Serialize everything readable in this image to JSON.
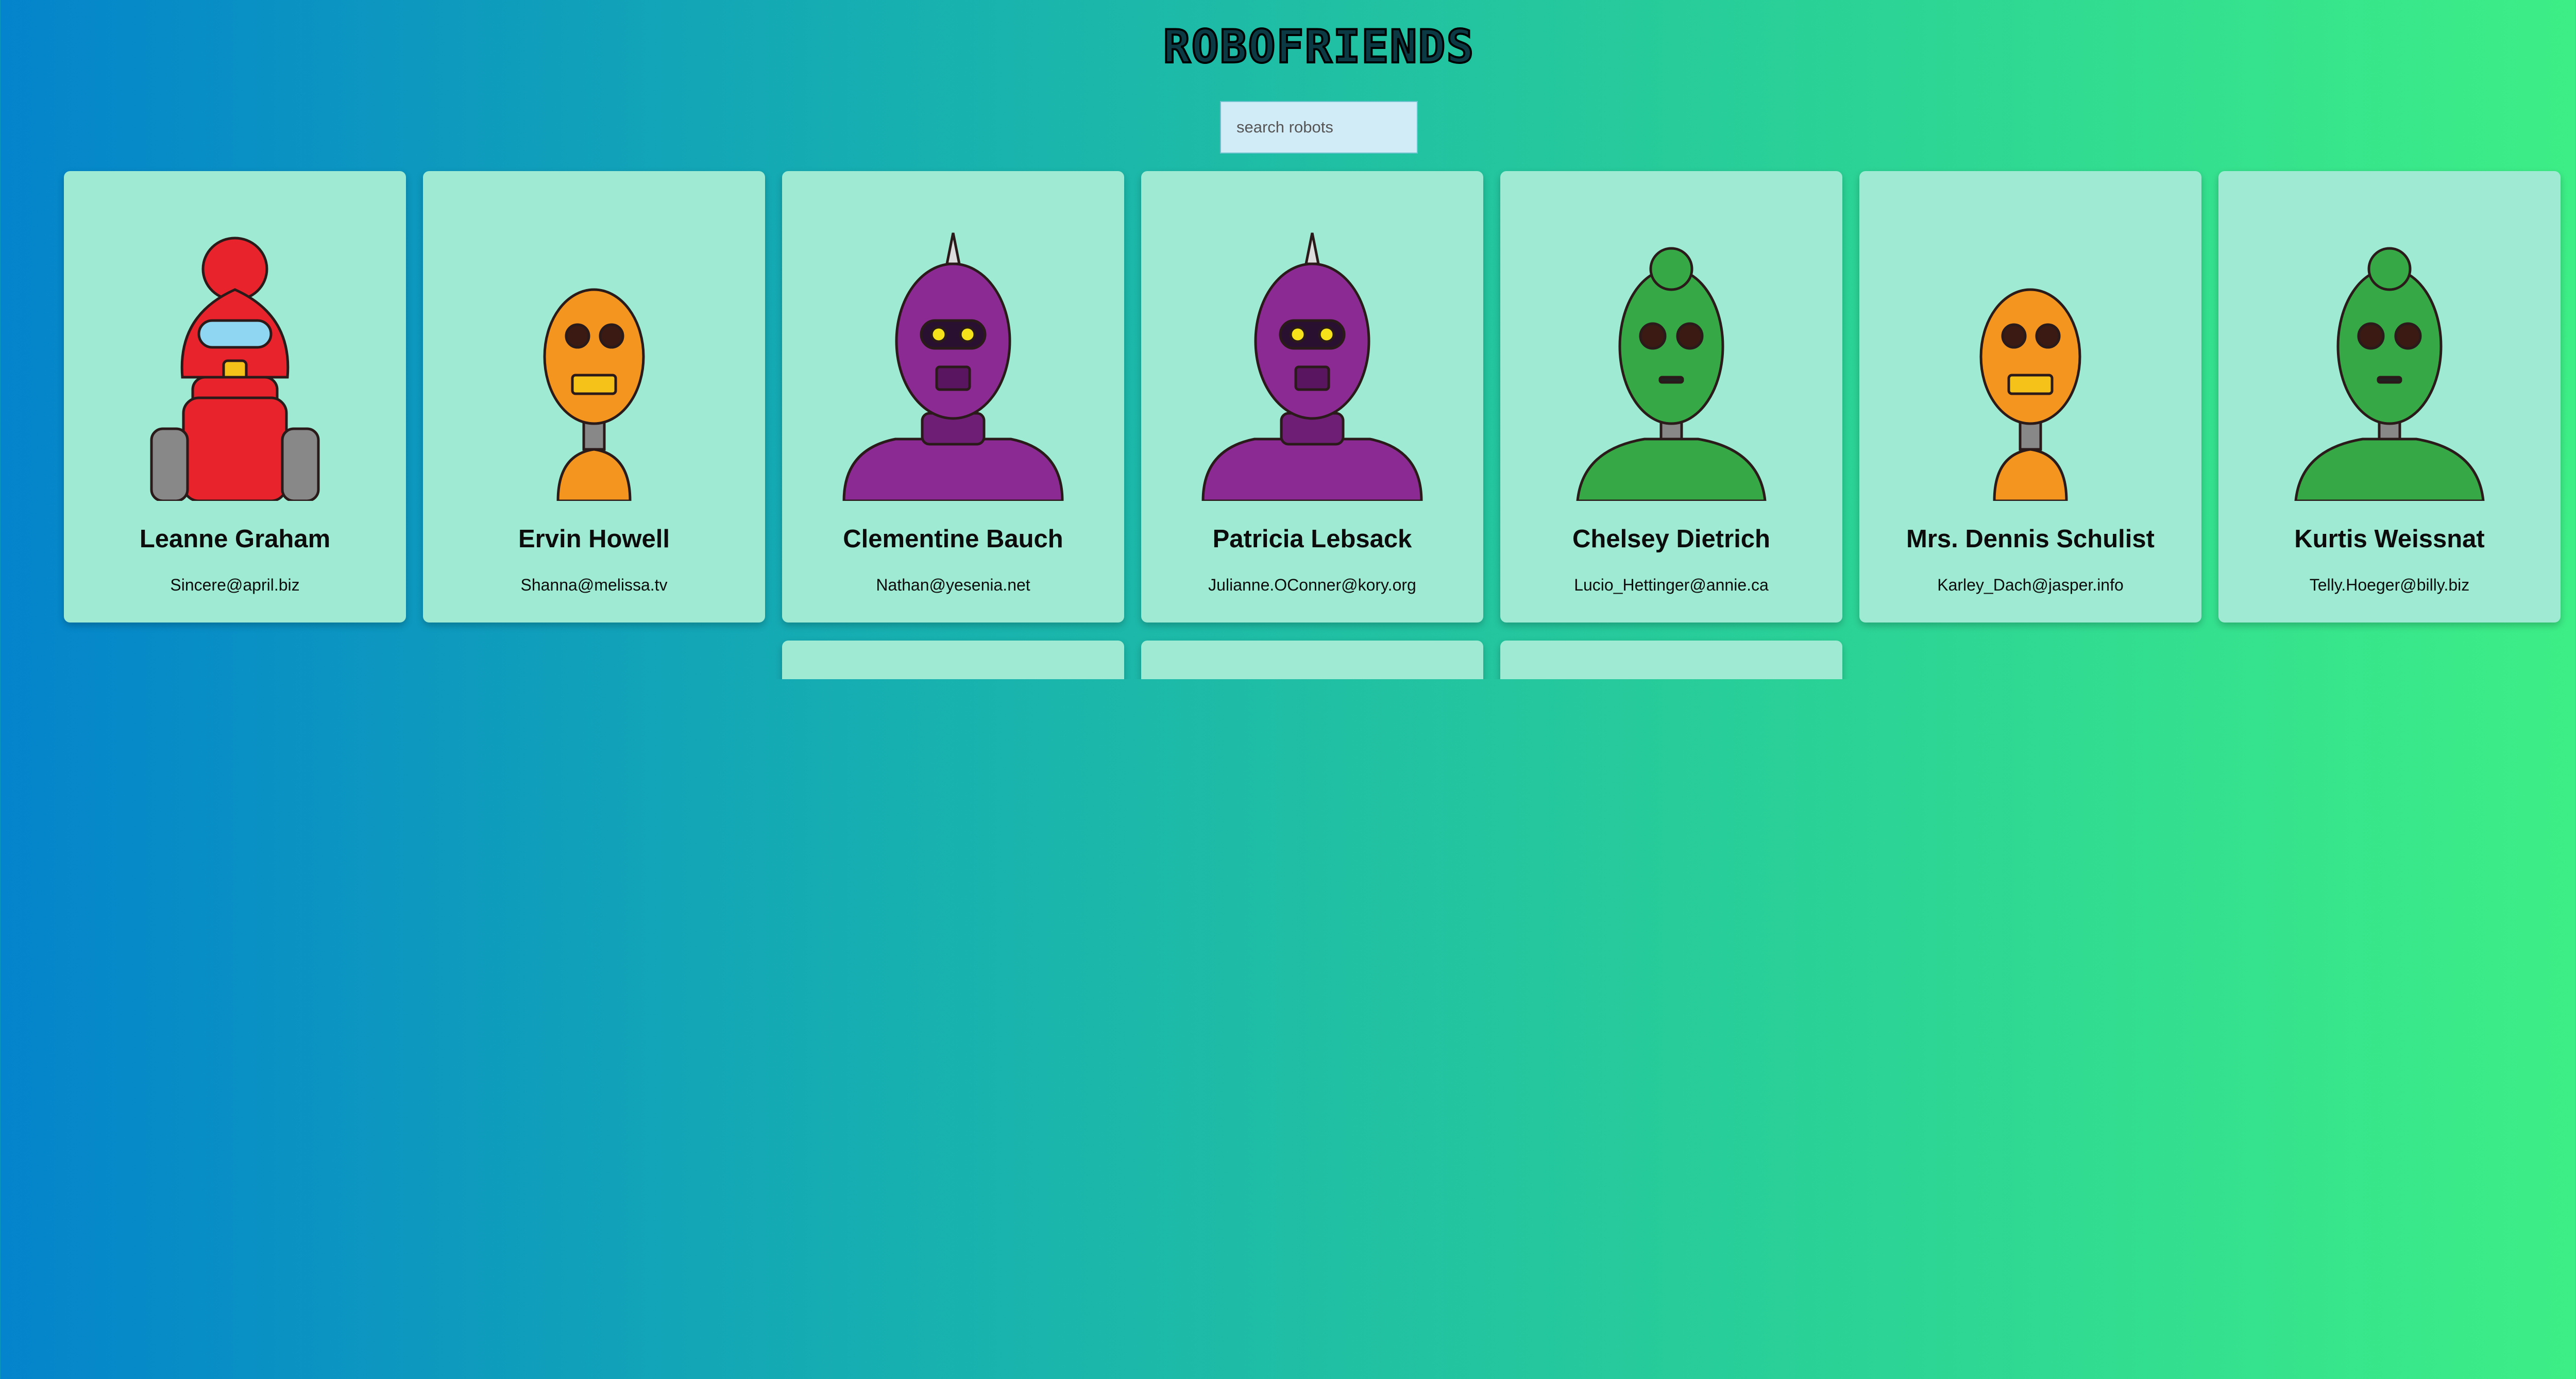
{
  "app": {
    "title": "ROBOFRIENDS"
  },
  "search": {
    "placeholder": "search robots",
    "value": ""
  },
  "cards": [
    {
      "name": "Leanne Graham",
      "email": "Sincere@april.biz",
      "robot": "red-robot-icon",
      "color": "#e8232b"
    },
    {
      "name": "Ervin Howell",
      "email": "Shanna@melissa.tv",
      "robot": "orange-robot-icon",
      "color": "#f4951f"
    },
    {
      "name": "Clementine Bauch",
      "email": "Nathan@yesenia.net",
      "robot": "purple-robot-icon",
      "color": "#8a2a92"
    },
    {
      "name": "Patricia Lebsack",
      "email": "Julianne.OConner@kory.org",
      "robot": "purple-robot-icon",
      "color": "#8a2a92"
    },
    {
      "name": "Chelsey Dietrich",
      "email": "Lucio_Hettinger@annie.ca",
      "robot": "green-robot-icon",
      "color": "#36a845"
    },
    {
      "name": "Mrs. Dennis Schulist",
      "email": "Karley_Dach@jasper.info",
      "robot": "orange-robot-icon",
      "color": "#f4951f"
    },
    {
      "name": "Kurtis Weissnat",
      "email": "Telly.Hoeger@billy.biz",
      "robot": "green-robot-icon",
      "color": "#36a845"
    },
    {
      "name": "",
      "email": "",
      "robot": "",
      "color": ""
    },
    {
      "name": "",
      "email": "",
      "robot": "",
      "color": ""
    },
    {
      "name": "",
      "email": "",
      "robot": "",
      "color": ""
    }
  ]
}
